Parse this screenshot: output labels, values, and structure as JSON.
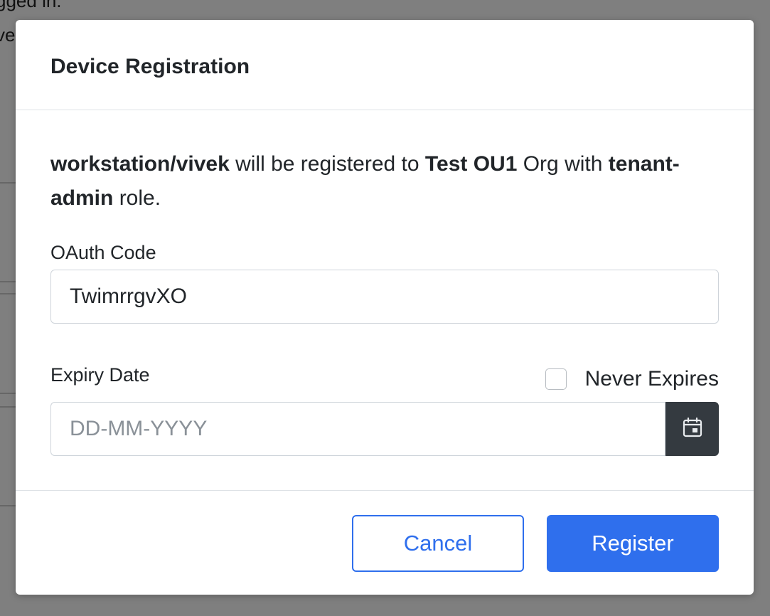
{
  "background": {
    "line1": "gged in.",
    "line2": "ve"
  },
  "modal": {
    "title": "Device Registration",
    "intro": {
      "device": "workstation/vivek",
      "text1": " will be registered to ",
      "org": "Test OU1",
      "text2": " Org with ",
      "role": "tenant-admin",
      "text3": " role."
    },
    "oauth": {
      "label": "OAuth Code",
      "value": "TwimrrgvXO"
    },
    "expiry": {
      "label": "Expiry Date",
      "placeholder": "DD-MM-YYYY",
      "never_expires_label": "Never Expires",
      "never_expires_checked": false,
      "calendar_icon": "calendar-icon"
    },
    "buttons": {
      "cancel": "Cancel",
      "register": "Register"
    }
  },
  "colors": {
    "primary": "#2f6fed",
    "calendar_button": "#343a40",
    "backdrop": "rgba(0,0,0,0.5)"
  }
}
